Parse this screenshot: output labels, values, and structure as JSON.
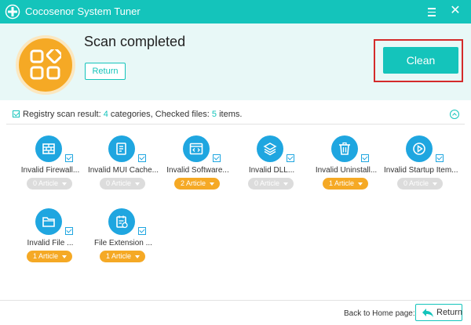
{
  "window": {
    "title": "Cocosenor System Tuner"
  },
  "header": {
    "scan_title": "Scan completed",
    "return_label": "Return",
    "clean_label": "Clean"
  },
  "result": {
    "prefix": "Registry scan result:",
    "categories_count": "4",
    "categories_word": "categories, Checked files:",
    "files_count": "5",
    "items_word": "items."
  },
  "categories": [
    {
      "name": "Invalid Firewall...",
      "pill": "0 Article",
      "active": false,
      "icon": "firewall-icon"
    },
    {
      "name": "Invalid MUI Cache...",
      "pill": "0 Article",
      "active": false,
      "icon": "document-icon"
    },
    {
      "name": "Invalid Software...",
      "pill": "2 Article",
      "active": true,
      "icon": "code-window-icon"
    },
    {
      "name": "Invalid DLL...",
      "pill": "0 Article",
      "active": false,
      "icon": "layers-icon"
    },
    {
      "name": "Invalid Uninstall...",
      "pill": "1 Article",
      "active": true,
      "icon": "trash-icon"
    },
    {
      "name": "Invalid Startup Item...",
      "pill": "0 Article",
      "active": false,
      "icon": "play-icon"
    },
    {
      "name": "Invalid File ...",
      "pill": "1 Article",
      "active": true,
      "icon": "folder-icon"
    },
    {
      "name": "File Extension ...",
      "pill": "1 Article",
      "active": true,
      "icon": "file-extension-icon"
    }
  ],
  "footer": {
    "back_label": "Back to Home page:",
    "return_label": "Return"
  },
  "colors": {
    "accent": "#14c4bb",
    "category_blue": "#1fa6e0",
    "orange": "#f5a925",
    "highlight_red": "#d42b2b"
  }
}
